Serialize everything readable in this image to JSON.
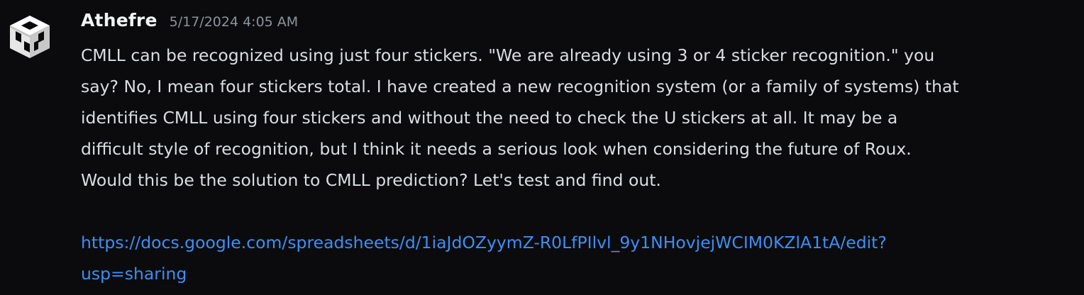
{
  "message": {
    "author": "Athefre",
    "timestamp": "5/17/2024 4:05 AM",
    "avatar_icon": "cube-logo-icon",
    "lines": [
      "CMLL can be recognized using just four stickers. \"We are already using 3 or 4 sticker recognition.\" you",
      "say? No, I mean four stickers total. I have created a new recognition system (or a family of systems) that",
      "identifies CMLL using four stickers and without the need to check the U stickers at all. It may be a",
      "difficult style of recognition, but I think it needs a serious look when considering the future of Roux.",
      "Would this be the solution to CMLL prediction? Let's test and find out."
    ],
    "link": {
      "line1": "https://docs.google.com/spreadsheets/d/1iaJdOZyymZ-R0LfPIlvl_9y1NHovjejWCIM0KZlA1tA/edit?",
      "line2": "usp=sharing",
      "href": "https://docs.google.com/spreadsheets/d/1iaJdOZyymZ-R0LfPIlvl_9y1NHovjejWCIM0KZlA1tA/edit?usp=sharing"
    }
  },
  "colors": {
    "background": "#0b0b0e",
    "username": "#f2f3f5",
    "timestamp": "#8e9297",
    "text": "#dbdee1",
    "link": "#3d8ff5"
  }
}
